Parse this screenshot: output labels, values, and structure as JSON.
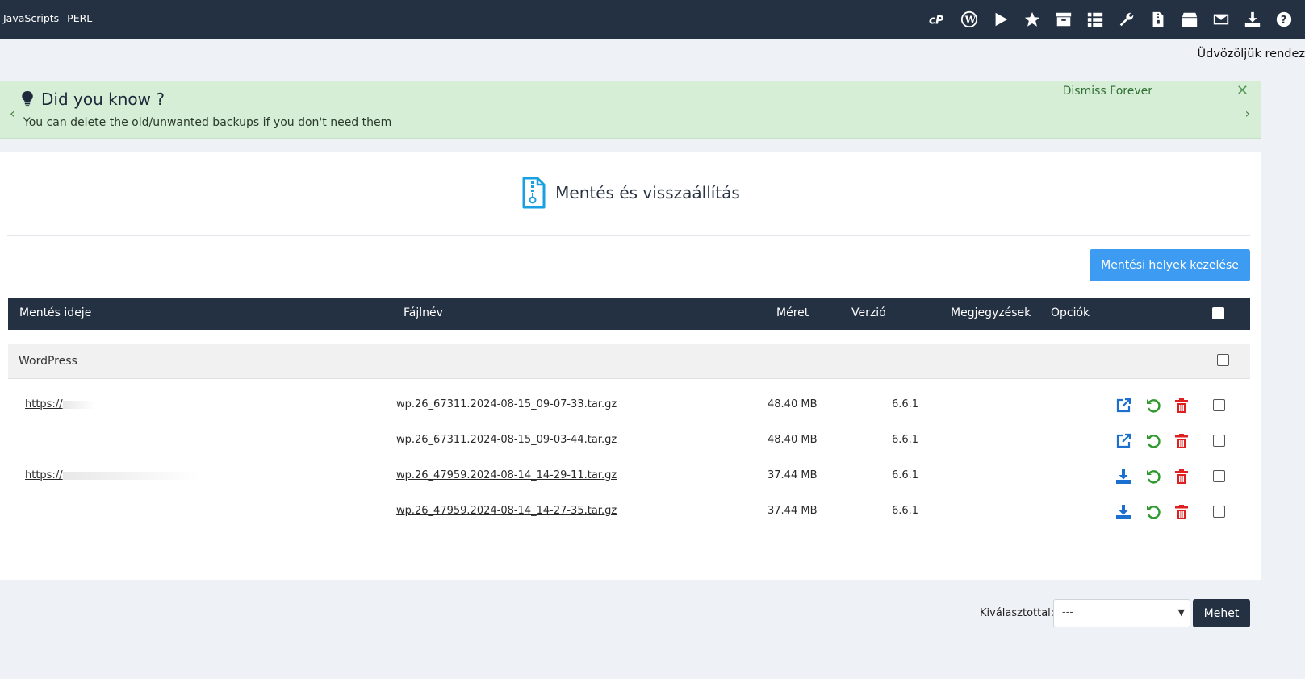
{
  "topbar": {
    "links": [
      "JavaScripts",
      "PERL"
    ],
    "icons": [
      "cpanel-icon",
      "wordpress-icon",
      "play-icon",
      "star-icon",
      "archive-icon",
      "list-icon",
      "wrench-icon",
      "zip-file-icon",
      "box-icon",
      "mail-icon",
      "download-icon",
      "help-icon"
    ]
  },
  "greeting": "Üdvözöljük rendez",
  "tip": {
    "title": "Did you know ?",
    "text": "You can delete the old/unwanted backups if you don't need them",
    "dismiss": "Dismiss Forever",
    "close": "✕",
    "prev": "‹",
    "next": "›"
  },
  "page": {
    "title": "Mentés és visszaállítás",
    "manage_button": "Mentési helyek kezelése"
  },
  "table": {
    "headers": {
      "time": "Mentés ideje",
      "filename": "Fájlnév",
      "size": "Méret",
      "version": "Verzió",
      "notes": "Megjegyzések",
      "options": "Opciók"
    },
    "group": "WordPress",
    "rows": [
      {
        "url": "https://",
        "filename": "wp.26_67311.2024-08-15_09-07-33.tar.gz",
        "size": "48.40 MB",
        "version": "6.6.1",
        "action": "open-external-icon"
      },
      {
        "url": "",
        "filename": "wp.26_67311.2024-08-15_09-03-44.tar.gz",
        "size": "48.40 MB",
        "version": "6.6.1",
        "action": "open-external-icon"
      },
      {
        "url": "https://",
        "filename": "wp.26_47959.2024-08-14_14-29-11.tar.gz",
        "size": "37.44 MB",
        "version": "6.6.1",
        "action": "download-icon"
      },
      {
        "url": "",
        "filename": "wp.26_47959.2024-08-14_14-27-35.tar.gz",
        "size": "37.44 MB",
        "version": "6.6.1",
        "action": "download-icon"
      }
    ]
  },
  "bulk": {
    "label": "Kiválasztottal:",
    "selected": "---",
    "go": "Mehet"
  },
  "colors": {
    "topbar": "#243142",
    "tip_bg": "#d6edd6",
    "primary_button": "#3d9bf2",
    "action_blue": "#1a6fd1",
    "restore_green": "#2e9a2e",
    "delete_red": "#e02020"
  }
}
